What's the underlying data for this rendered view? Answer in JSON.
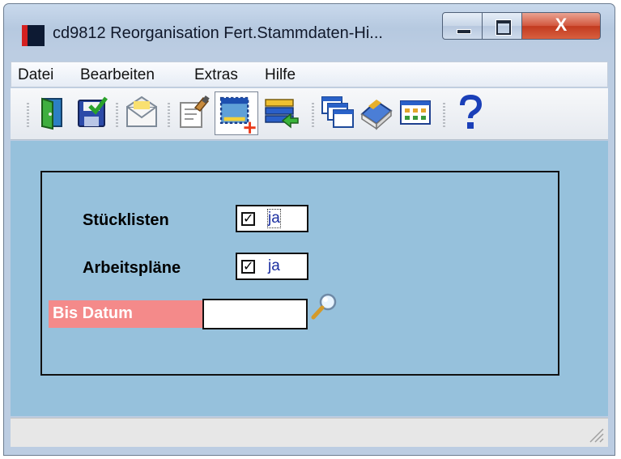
{
  "window": {
    "title": "cd9812 Reorganisation Fert.Stammdaten-Hi...",
    "close_glyph": "X"
  },
  "menu": [
    "Datei",
    "Bearbeiten",
    "Extras",
    "Hilfe"
  ],
  "toolbar": {
    "icons": [
      "exit-door-icon",
      "save-icon",
      "mail-icon",
      "edit-document-icon",
      "new-record-icon",
      "transfer-list-icon",
      "windows-icon",
      "book-icon",
      "grid-view-icon",
      "help-icon"
    ]
  },
  "form": {
    "stuecklisten": {
      "label": "Stücklisten",
      "checked": true,
      "value": "ja"
    },
    "arbeitsplaene": {
      "label": "Arbeitspläne",
      "checked": true,
      "value": "ja"
    },
    "bis_datum": {
      "label": "Bis Datum",
      "value": ""
    }
  },
  "colors": {
    "workspace": "#96c1dc",
    "required_label": "#f48a8a",
    "check_value_text": "#1a2ea0"
  }
}
